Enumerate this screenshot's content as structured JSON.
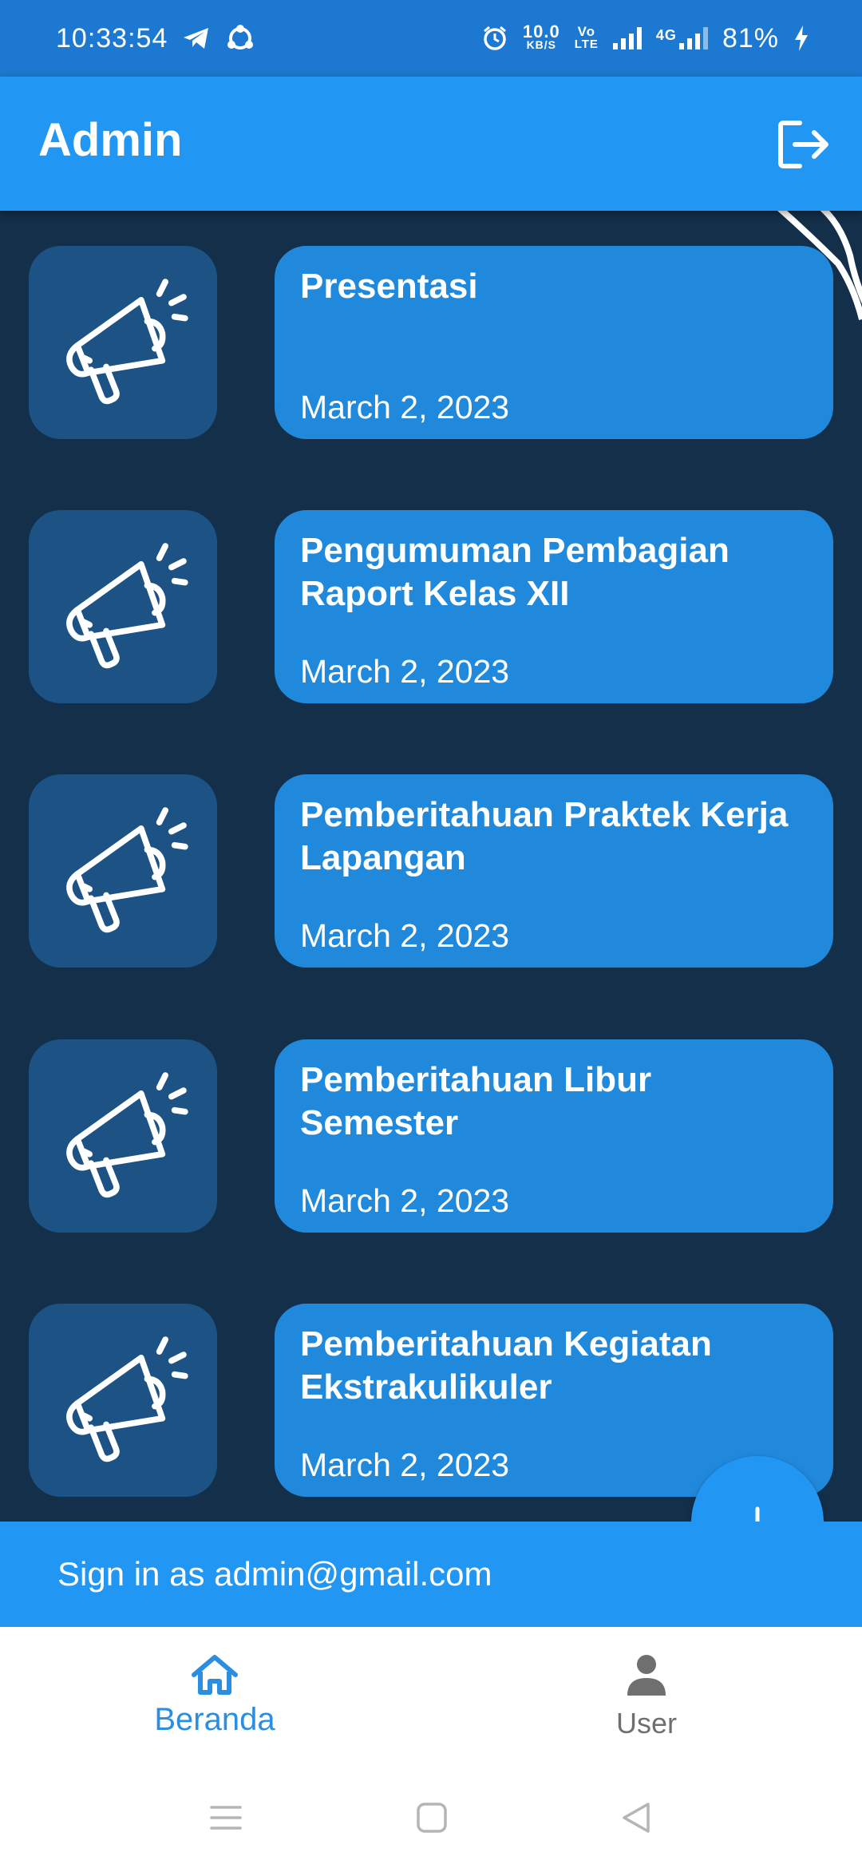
{
  "status_bar": {
    "time": "10:33:54",
    "net_speed_value": "10.0",
    "net_speed_unit": "KB/S",
    "volte_top": "Vo",
    "volte_bottom": "LTE",
    "network_type": "4G",
    "battery": "81%"
  },
  "app_bar": {
    "title": "Admin",
    "logout_icon": "logout-icon"
  },
  "announcements": [
    {
      "title": "Presentasi",
      "date": "March 2, 2023"
    },
    {
      "title": "Pengumuman Pembagian Raport Kelas XII",
      "date": "March 2, 2023"
    },
    {
      "title": "Pemberitahuan Praktek Kerja Lapangan",
      "date": "March 2, 2023"
    },
    {
      "title": "Pemberitahuan Libur Semester",
      "date": "March 2, 2023"
    },
    {
      "title": "Pemberitahuan Kegiatan Ekstrakulikuler",
      "date": "March 2, 2023"
    }
  ],
  "fab": {
    "icon": "plus-icon"
  },
  "signin": {
    "text": "Sign in as admin@gmail.com"
  },
  "bottom_nav": {
    "items": [
      {
        "label": "Beranda",
        "icon": "home-icon",
        "active": true
      },
      {
        "label": "User",
        "icon": "person-icon",
        "active": false
      }
    ]
  },
  "colors": {
    "primary": "#2196f3",
    "background": "#132f4a",
    "card": "#2189dc",
    "icon_tile": "#1c5384",
    "active_nav": "#2a8fe0",
    "inactive_nav": "#6f6f6f"
  }
}
